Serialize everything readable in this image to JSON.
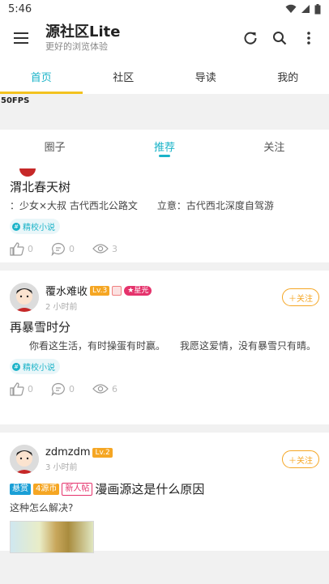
{
  "status": {
    "time": "5:46"
  },
  "app": {
    "title": "源社区Lite",
    "subtitle": "更好的浏览体验"
  },
  "main_tabs": [
    "首页",
    "社区",
    "导读",
    "我的"
  ],
  "fps": "50FPS",
  "sub_tabs": [
    "圈子",
    "推荐",
    "关注"
  ],
  "posts": [
    {
      "title": "渭北春天树",
      "body": "：少女×大叔 古代西北公路文　　立意：古代西北深度自驾游",
      "tag": "精校小说",
      "stats": {
        "likes": "0",
        "comments": "0",
        "views": "3"
      }
    },
    {
      "user": "覆水难收",
      "level": "Lv.3",
      "star_badge": "★星光",
      "time": "2 小时前",
      "follow": "＋关注",
      "title": "再暴雪时分",
      "body": "　　你看这生活，有时操蛋有时赢。　　我愿这爱情，没有暴雪只有晴。",
      "tag": "精校小说",
      "stats": {
        "likes": "0",
        "comments": "0",
        "views": "6"
      }
    },
    {
      "user": "zdmzdm",
      "level": "Lv.2",
      "time": "3 小时前",
      "follow": "＋关注",
      "badges": {
        "reward": "悬赏",
        "coin": "4源币",
        "new": "新人帖"
      },
      "title": "漫画源这是什么原因",
      "body": "这种怎么解决?"
    }
  ],
  "colors": {
    "accent": "#1ab3c8",
    "indicator": "#f3c21f",
    "follow": "#f5a623",
    "star": "#e5336c"
  }
}
